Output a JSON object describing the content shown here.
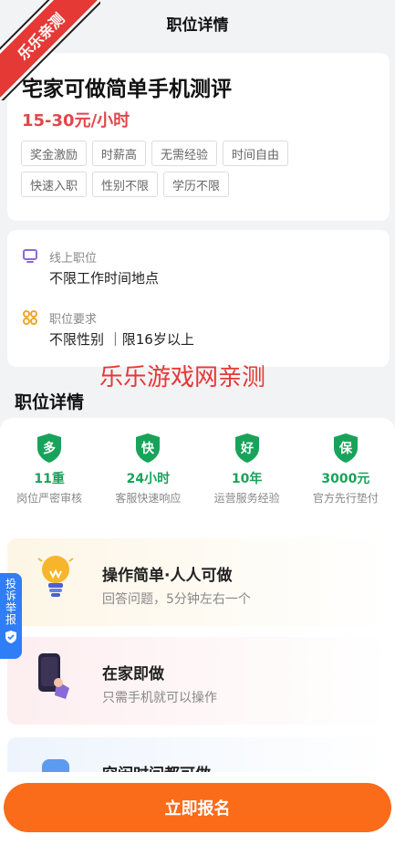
{
  "header": {
    "title": "职位详情"
  },
  "watermark": {
    "corner_text": "乐乐亲测",
    "center_text": "乐乐游戏网亲测"
  },
  "job": {
    "title": "宅家可做简单手机测评",
    "salary": "15-30元/小时",
    "tags": [
      "奖金激励",
      "时薪高",
      "无需经验",
      "时间自由",
      "快速入职",
      "性别不限",
      "学历不限"
    ]
  },
  "info": {
    "location_label": "线上职位",
    "location_value": "不限工作时间地点",
    "requirement_label": "职位要求",
    "requirement_value": "不限性别 ｜限16岁以上"
  },
  "details": {
    "section_title": "职位详情",
    "badges": [
      {
        "icon_char": "多",
        "value": "11重",
        "label": "岗位严密审核"
      },
      {
        "icon_char": "快",
        "value": "24小时",
        "label": "客服快速响应"
      },
      {
        "icon_char": "好",
        "value": "10年",
        "label": "运营服务经验"
      },
      {
        "icon_char": "保",
        "value": "3000元",
        "label": "官方先行垫付"
      }
    ],
    "features": [
      {
        "title": "操作简单·人人可做",
        "subtitle": "回答问题，5分钟左右一个",
        "icon": "lightbulb-icon"
      },
      {
        "title": "在家即做",
        "subtitle": "只需手机就可以操作",
        "icon": "phone-hand-icon"
      },
      {
        "title": "空闲时间都可做",
        "subtitle": "",
        "icon": "clock-icon"
      }
    ]
  },
  "report_tab": {
    "label": "投诉举报"
  },
  "apply": {
    "label": "立即报名"
  },
  "colors": {
    "accent": "#fa6b1a",
    "salary": "#e2464a",
    "badge_green": "#18a35a",
    "report_blue": "#2f7df7"
  }
}
